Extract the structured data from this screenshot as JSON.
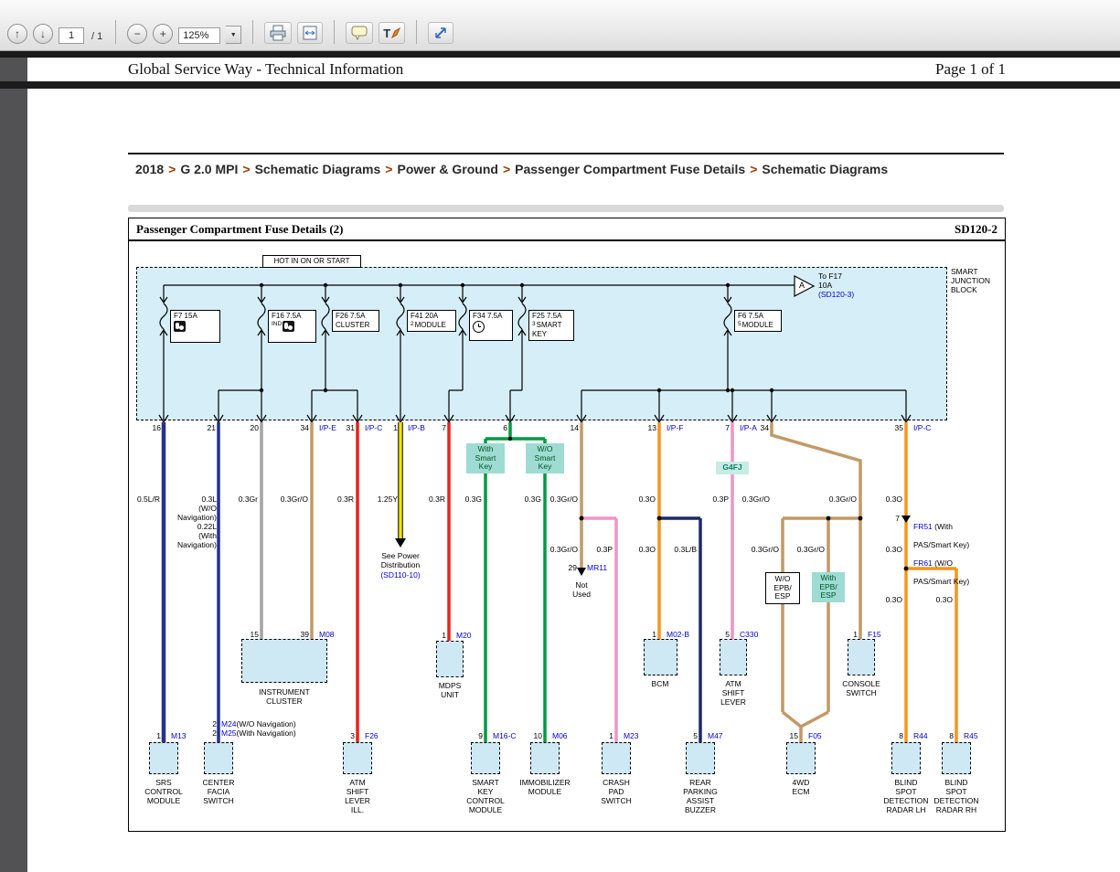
{
  "toolbar": {
    "page_value": "1",
    "page_total": "/ 1",
    "zoom_value": "125%",
    "icons": {
      "up": "↑",
      "down": "↓",
      "minus": "−",
      "plus": "+",
      "dropdown": "▼"
    }
  },
  "header": {
    "title": "Global Service Way - Technical Information",
    "page_indicator": "Page 1 of 1"
  },
  "breadcrumb": {
    "separator": ">",
    "items": [
      "2018",
      "G 2.0 MPI",
      "Schematic Diagrams",
      "Power & Ground",
      "Passenger Compartment Fuse Details",
      "Schematic Diagrams"
    ]
  },
  "doc": {
    "title": "Passenger Compartment Fuse Details (2)",
    "code": "SD120-2"
  },
  "diagram": {
    "hot_label": "HOT IN ON OR START",
    "junction_block_label": [
      "SMART",
      "JUNCTION",
      "BLOCK"
    ],
    "triangle_label": "A",
    "to_f17": [
      "To F17",
      "10A",
      "(SD120-3)"
    ],
    "fuses": [
      {
        "name": "F7 15A",
        "icon": "airbag-icon"
      },
      {
        "name": "F16 7.5A",
        "tag": "IND",
        "icon": "airbag-icon"
      },
      {
        "name": "F26 7.5A",
        "load": "CLUSTER"
      },
      {
        "name": "F41 20A",
        "num": "2",
        "load": "MODULE"
      },
      {
        "name": "F34 7.5A",
        "icon": "clock-icon"
      },
      {
        "name": "F25 7.5A",
        "num": "3",
        "load": "SMART KEY"
      },
      {
        "name": "F6 7.5A",
        "num": "5",
        "load": "MODULE"
      }
    ],
    "exits": [
      {
        "pin": "16"
      },
      {
        "pin": "21"
      },
      {
        "pin": "20"
      },
      {
        "pin": "34",
        "conn": "I/P-E"
      },
      {
        "pin": "31",
        "conn": "I/P-C"
      },
      {
        "pin": "1",
        "conn": "I/P-B"
      },
      {
        "pin": "7"
      },
      {
        "pin": "6"
      },
      {
        "pin": "14"
      },
      {
        "pin": "13",
        "conn": "I/P-F"
      },
      {
        "pin": "7",
        "conn": "I/P-A"
      },
      {
        "pin": "34"
      },
      {
        "pin": "35",
        "conn": "I/P-C"
      }
    ],
    "wire_labels": [
      "0.5L/R",
      "0.3Gr",
      "0.3Gr/O",
      "0.3R",
      "1.25Y",
      "0.3R",
      "0.3G",
      "0.3G",
      "0.3Gr/O",
      "0.3O",
      "0.3P",
      "0.3Gr/O",
      "0.3Gr/O",
      "0.3O",
      "0.3Gr/O",
      "0.3P",
      "0.3O",
      "0.3L/B",
      "0.3Gr/O",
      "0.3Gr/O",
      "0.3O",
      "0.3O",
      "0.3O"
    ],
    "nav_wire_label": [
      "0.3L",
      "(W/O",
      "Navigation)",
      "0.22L",
      "(With",
      "Navigation)"
    ],
    "tags": {
      "with_smart_key": [
        "With",
        "Smart",
        "Key"
      ],
      "wo_smart_key": [
        "W/O",
        "Smart",
        "Key"
      ],
      "g4fj": "G4FJ",
      "wo_epb": [
        "W/O",
        "EPB/",
        "ESP"
      ],
      "with_epb": [
        "With",
        "EPB/",
        "ESP"
      ]
    },
    "see_power": {
      "text": [
        "See Power",
        "Distribution"
      ],
      "ref": "(SD110-10)"
    },
    "fr": {
      "pin": "7",
      "a_id": "FR51",
      "a_rest": " (With",
      "a_rest2": "PAS/Smart Key)",
      "b_id": "FR61",
      "b_rest": " (W/O",
      "b_rest2": "PAS/Smart Key)"
    },
    "mr": {
      "pin": "29",
      "id": "MR11",
      "note": [
        "Not",
        "Used"
      ]
    },
    "mid_connectors": [
      {
        "pin_a": "15",
        "pin_b": "39",
        "id_b": "M08",
        "label": [
          "INSTRUMENT",
          "CLUSTER"
        ]
      },
      {
        "pin": "1",
        "id": "M20",
        "label": [
          "MDPS",
          "UNIT"
        ]
      },
      {
        "pin": "1",
        "id": "M02-B",
        "label": [
          "BCM"
        ]
      },
      {
        "pin": "5",
        "id": "C330",
        "label": [
          "ATM",
          "SHIFT",
          "LEVER"
        ]
      },
      {
        "pin": "1",
        "id": "F15",
        "label": [
          "CONSOLE",
          "SWITCH"
        ]
      }
    ],
    "bottom_connectors": [
      {
        "pin": "1",
        "id": "M13",
        "label": [
          "SRS",
          "CONTROL",
          "MODULE"
        ]
      },
      {
        "rows": [
          {
            "pin": "2",
            "id": "M24",
            "suffix": "(W/O Navigation)"
          },
          {
            "pin": "2",
            "id": "M25",
            "suffix": "(With Navigation)"
          }
        ],
        "label": [
          "CENTER",
          "FACIA",
          "SWITCH"
        ]
      },
      {
        "pin": "3",
        "id": "F26",
        "label": [
          "ATM",
          "SHIFT",
          "LEVER",
          "ILL."
        ]
      },
      {
        "pin": "9",
        "id": "M16-C",
        "label": [
          "SMART",
          "KEY",
          "CONTROL",
          "MODULE"
        ]
      },
      {
        "pin": "10",
        "id": "M06",
        "label": [
          "IMMOBILIZER",
          "MODULE"
        ]
      },
      {
        "pin": "1",
        "id": "M23",
        "label": [
          "CRASH",
          "PAD",
          "SWITCH"
        ]
      },
      {
        "pin": "5",
        "id": "M47",
        "label": [
          "REAR",
          "PARKING",
          "ASSIST",
          "BUZZER"
        ]
      },
      {
        "pin": "15",
        "id": "F05",
        "label": [
          "4WD",
          "ECM"
        ]
      },
      {
        "pin": "8",
        "id": "R44",
        "label": [
          "BLIND",
          "SPOT",
          "DETECTION",
          "RADAR LH"
        ]
      },
      {
        "pin": "8",
        "id": "R45",
        "label": [
          "BLIND",
          "SPOT",
          "DETECTION",
          "RADAR RH"
        ]
      }
    ],
    "colors": {
      "blue_ref": "#0202cc",
      "wire_navy": "#23318f",
      "wire_navy_black": "#1d2a66",
      "wire_gray": "#a3a3a3",
      "wire_tan": "#c29a66",
      "wire_red": "#e8231c",
      "wire_yellow": "#f6e300",
      "wire_green": "#009a44",
      "wire_orange": "#f7941d",
      "wire_pink": "#f193c7",
      "sjb_fill": "#d6eef7",
      "connector_fill": "#cfe9f4",
      "tag_fill": "#9edcd3"
    }
  }
}
